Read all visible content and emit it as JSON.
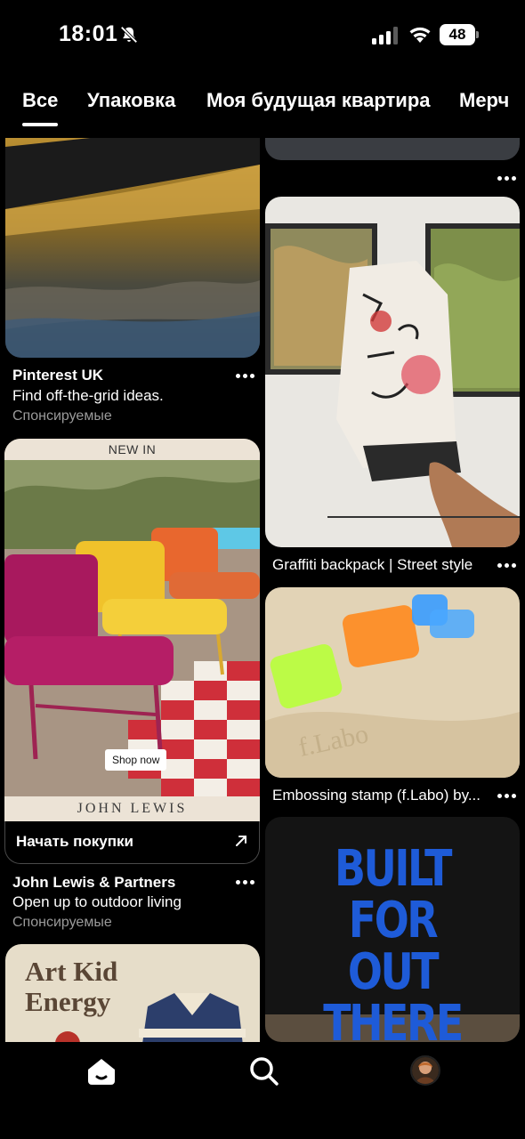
{
  "status_bar": {
    "time": "18:01",
    "battery": "48",
    "icons": [
      "bell-muted-icon",
      "cellular-signal-icon",
      "wifi-icon",
      "battery-icon"
    ]
  },
  "tabs": [
    {
      "label": "Все",
      "selected": true
    },
    {
      "label": "Упаковка",
      "selected": false
    },
    {
      "label": "Моя будущая квартира",
      "selected": false
    },
    {
      "label": "Мерч",
      "selected": false
    }
  ],
  "feed": {
    "left": [
      {
        "type": "sponsored",
        "title": "Pinterest UK",
        "description": "Find off-the-grid ideas.",
        "sponsored_label": "Спонсируемые"
      },
      {
        "type": "sponsored",
        "badge": "NEW IN",
        "brand_footer": "JOHN LEWIS",
        "shop_button": "Shop now",
        "cta_label": "Начать покупки",
        "title": "John Lewis & Partners",
        "description": "Open up to outdoor living",
        "sponsored_label": "Спонсируемые"
      },
      {
        "type": "pin",
        "image_text_line1": "Art Kid",
        "image_text_line2": "Energy"
      }
    ],
    "right": [
      {
        "type": "pin",
        "title": ""
      },
      {
        "type": "pin",
        "title": "Graffiti backpack | Street style"
      },
      {
        "type": "pin",
        "title": "Embossing stamp (f.Labo) by..."
      },
      {
        "type": "pin",
        "image_text_line1": "BUILT FOR",
        "image_text_line2": "OUT THERE"
      }
    ]
  },
  "bottom_nav": {
    "items": [
      "home-icon",
      "search-icon",
      "profile-avatar"
    ]
  },
  "colors": {
    "background": "#000000",
    "text_primary": "#ffffff",
    "text_secondary": "#9a9a9a",
    "built_for_blue": "#1e5bd8"
  }
}
